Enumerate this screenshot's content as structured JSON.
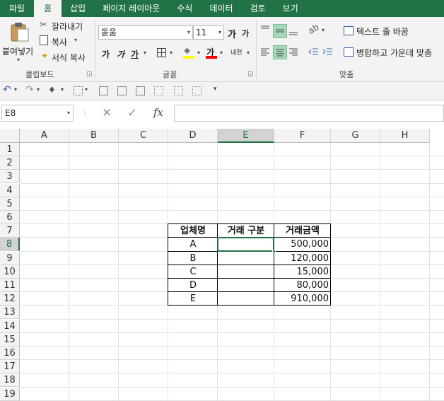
{
  "tabs": [
    {
      "label": "파일",
      "active": false
    },
    {
      "label": "홈",
      "active": true
    },
    {
      "label": "삽입",
      "active": false
    },
    {
      "label": "페이지 레이아웃",
      "active": false
    },
    {
      "label": "수식",
      "active": false
    },
    {
      "label": "데이터",
      "active": false
    },
    {
      "label": "검토",
      "active": false
    },
    {
      "label": "보기",
      "active": false
    }
  ],
  "ribbon": {
    "clipboard": {
      "paste_label": "붙여넣기",
      "cut_label": "잘라내기",
      "copy_label": "복사",
      "format_painter_label": "서식 복사",
      "group_label": "클립보드"
    },
    "font": {
      "font_name": "돋움",
      "font_size": "11",
      "grow_label": "가",
      "shrink_label": "가",
      "bold_label": "가",
      "italic_label": "가",
      "underline_label": "가",
      "font_color_label": "가",
      "phonetic_label": "내천",
      "group_label": "글꼴",
      "fill_color": "#ffff00",
      "font_color": "#ff0000"
    },
    "alignment": {
      "wrap_text_label": "텍스트 줄 바꿈",
      "merge_label": "병합하고 가운데 맞춤",
      "group_label": "맞춤"
    }
  },
  "formula_bar": {
    "name_box": "E8",
    "fx_label": "fx",
    "formula": ""
  },
  "grid": {
    "columns": [
      "A",
      "B",
      "C",
      "D",
      "E",
      "F",
      "G",
      "H"
    ],
    "rows": [
      "1",
      "2",
      "3",
      "4",
      "5",
      "6",
      "7",
      "8",
      "9",
      "10",
      "11",
      "12",
      "13",
      "14",
      "15",
      "16",
      "17",
      "18",
      "19"
    ],
    "selected_column": "E",
    "selected_row": "8",
    "selected_cell": "E8"
  },
  "table": {
    "headers": [
      "업체명",
      "거래 구분",
      "거래금액"
    ],
    "rows": [
      {
        "name": "A",
        "type": "",
        "amount": "500,000"
      },
      {
        "name": "B",
        "type": "",
        "amount": "120,000"
      },
      {
        "name": "C",
        "type": "",
        "amount": "15,000"
      },
      {
        "name": "D",
        "type": "",
        "amount": "80,000"
      },
      {
        "name": "E",
        "type": "",
        "amount": "910,000"
      }
    ]
  },
  "colors": {
    "brand": "#217346",
    "selection": "#217346",
    "align_active": "#a6d7b8"
  }
}
